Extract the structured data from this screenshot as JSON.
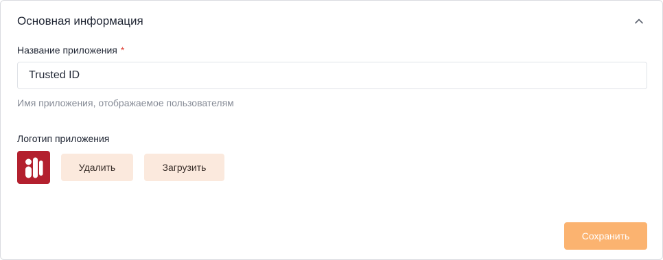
{
  "section": {
    "title": "Основная информация",
    "collapse_icon": "chevron-up-icon"
  },
  "app_name": {
    "label": "Название приложения",
    "required_mark": "*",
    "value": "Trusted ID",
    "helper": "Имя приложения, отображаемое пользователям"
  },
  "logo": {
    "label": "Логотип приложения",
    "icon": "trusted-id-logo",
    "delete_label": "Удалить",
    "upload_label": "Загрузить"
  },
  "actions": {
    "save_label": "Сохранить"
  },
  "colors": {
    "accent": "#fbb370",
    "soft_button_bg": "#fbe9dd",
    "logo_bg": "#b3202e",
    "required": "#e0453a"
  }
}
